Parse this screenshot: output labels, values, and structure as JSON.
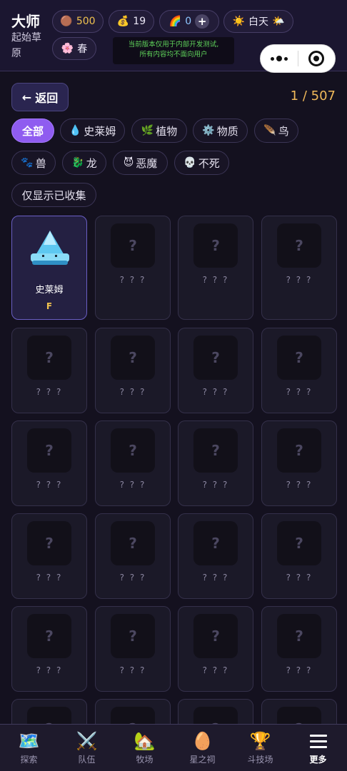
{
  "header": {
    "player_name": "大师",
    "location": "起始草原",
    "coins": "500",
    "coin_icon": "brown-coin-icon",
    "bag_count": "19",
    "bag_icon": "money-bag-icon",
    "rainbow_count": "0",
    "rainbow_icon": "rainbow-icon",
    "plus_label": "+",
    "time_label": "白天",
    "time_icon": "sun-icon",
    "season_label": "春",
    "season_icon": "blossom-icon",
    "notice_line1": "当前版本仅用于内部开发测试,",
    "notice_line2": "所有内容均不面向用户"
  },
  "toolbar": {
    "back_label": "返回",
    "back_arrow": "←",
    "page_counter": "1 / 507"
  },
  "filters": {
    "all": {
      "label": "全部",
      "icon": ""
    },
    "slime": {
      "label": "史莱姆",
      "icon": "💧"
    },
    "plant": {
      "label": "植物",
      "icon": "🌿"
    },
    "matter": {
      "label": "物质",
      "icon": "⚙️"
    },
    "bird": {
      "label": "鸟",
      "icon": "🪶"
    },
    "beast": {
      "label": "兽",
      "icon": "🐾"
    },
    "dragon": {
      "label": "龙",
      "icon": "🐉"
    },
    "demon": {
      "label": "恶魔",
      "icon": "😈"
    },
    "undead": {
      "label": "不死",
      "icon": "💀"
    },
    "collected_only": {
      "label": "仅显示已收集"
    }
  },
  "collection": {
    "first": {
      "name": "史莱姆",
      "grade": "F"
    },
    "unknown_mark": "?",
    "unknown_name": "? ? ?"
  },
  "bottom_nav": {
    "explore": {
      "label": "探索",
      "icon": "🗺️"
    },
    "team": {
      "label": "队伍",
      "icon": "⚔️"
    },
    "ranch": {
      "label": "牧场",
      "icon": "🏡"
    },
    "shrine": {
      "label": "星之祠",
      "icon": "🥚"
    },
    "arena": {
      "label": "斗技场",
      "icon": "🏆"
    },
    "more": {
      "label": "更多"
    }
  },
  "colors": {
    "accent": "#8f5cf0",
    "counter": "#f0b95a",
    "notice_text": "#5fd35a",
    "background": "#14111f"
  }
}
